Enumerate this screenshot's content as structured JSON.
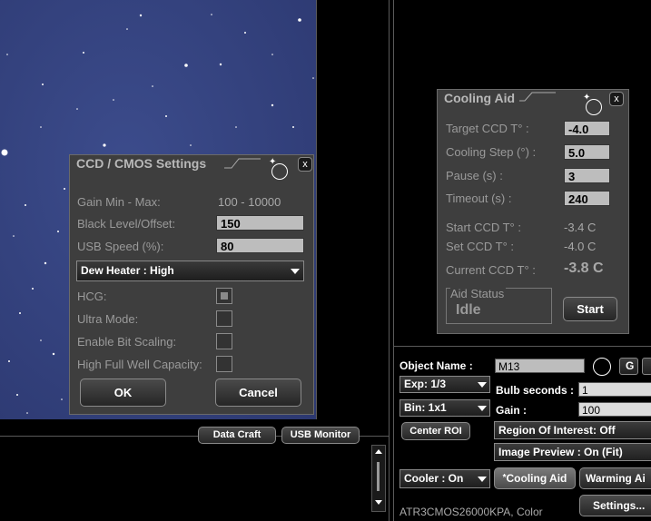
{
  "ccd_settings": {
    "title": "CCD / CMOS Settings",
    "close": "x",
    "gain_label": "Gain Min - Max:",
    "gain_value": "100 - 10000",
    "black_level_label": "Black Level/Offset:",
    "black_level_value": "150",
    "usb_speed_label": "USB Speed (%):",
    "usb_speed_value": "80",
    "dew_heater": "Dew Heater : High",
    "hcg_label": "HCG:",
    "ultra_mode_label": "Ultra Mode:",
    "bit_scaling_label": "Enable Bit Scaling:",
    "full_well_label": "High Full Well Capacity:",
    "ok_label": "OK",
    "cancel_label": "Cancel"
  },
  "cooling_aid": {
    "title": "Cooling Aid",
    "close": "x",
    "target_label": "Target CCD T° :",
    "target_value": "-4.0",
    "step_label": "Cooling Step (°) :",
    "step_value": "5.0",
    "pause_label": "Pause (s) :",
    "pause_value": "3",
    "timeout_label": "Timeout (s) :",
    "timeout_value": "240",
    "start_ccd_label": "Start CCD T° :",
    "start_ccd_value": "-3.4 C",
    "set_ccd_label": "Set CCD T° :",
    "set_ccd_value": "-4.0 C",
    "current_label": "Current CCD T° :",
    "current_value": "-3.8 C",
    "aid_status_label": "Aid Status",
    "aid_status_value": "Idle",
    "start_label": "Start"
  },
  "bottom_buttons": {
    "data_craft": "Data Craft",
    "usb_monitor": "USB Monitor"
  },
  "capture": {
    "object_name_label": "Object Name :",
    "object_name_value": "M13",
    "g_label": "G",
    "exp_value": "Exp: 1/3",
    "bulb_label": "Bulb seconds :",
    "bulb_value": "1",
    "bin_value": "Bin: 1x1",
    "gain_label": "Gain :",
    "gain_value": "100",
    "center_roi": "Center ROI",
    "roi_label": "Region Of Interest: Off",
    "preview_label": "Image Preview : On (Fit)",
    "cooler_value": "Cooler : On",
    "cooling_aid_btn": "Cooling Aid",
    "cooling_aid_mark": "*",
    "warming_aid_btn": "Warming Ai",
    "settings_btn": "Settings...",
    "camera_name": "ATR3CMOS26000KPA, Color"
  },
  "colors": {
    "panel_bg": "#3e3e3e",
    "sky": "#34427e",
    "field_bg": "#bdbdbd"
  }
}
